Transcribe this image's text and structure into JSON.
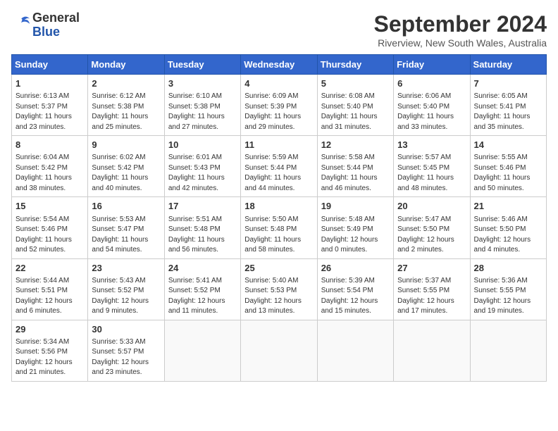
{
  "logo": {
    "general": "General",
    "blue": "Blue"
  },
  "header": {
    "month": "September 2024",
    "subtitle": "Riverview, New South Wales, Australia"
  },
  "weekdays": [
    "Sunday",
    "Monday",
    "Tuesday",
    "Wednesday",
    "Thursday",
    "Friday",
    "Saturday"
  ],
  "weeks": [
    [
      {
        "day": "1",
        "sunrise": "6:13 AM",
        "sunset": "5:37 PM",
        "daylight": "11 hours and 23 minutes."
      },
      {
        "day": "2",
        "sunrise": "6:12 AM",
        "sunset": "5:38 PM",
        "daylight": "11 hours and 25 minutes."
      },
      {
        "day": "3",
        "sunrise": "6:10 AM",
        "sunset": "5:38 PM",
        "daylight": "11 hours and 27 minutes."
      },
      {
        "day": "4",
        "sunrise": "6:09 AM",
        "sunset": "5:39 PM",
        "daylight": "11 hours and 29 minutes."
      },
      {
        "day": "5",
        "sunrise": "6:08 AM",
        "sunset": "5:40 PM",
        "daylight": "11 hours and 31 minutes."
      },
      {
        "day": "6",
        "sunrise": "6:06 AM",
        "sunset": "5:40 PM",
        "daylight": "11 hours and 33 minutes."
      },
      {
        "day": "7",
        "sunrise": "6:05 AM",
        "sunset": "5:41 PM",
        "daylight": "11 hours and 35 minutes."
      }
    ],
    [
      {
        "day": "8",
        "sunrise": "6:04 AM",
        "sunset": "5:42 PM",
        "daylight": "11 hours and 38 minutes."
      },
      {
        "day": "9",
        "sunrise": "6:02 AM",
        "sunset": "5:42 PM",
        "daylight": "11 hours and 40 minutes."
      },
      {
        "day": "10",
        "sunrise": "6:01 AM",
        "sunset": "5:43 PM",
        "daylight": "11 hours and 42 minutes."
      },
      {
        "day": "11",
        "sunrise": "5:59 AM",
        "sunset": "5:44 PM",
        "daylight": "11 hours and 44 minutes."
      },
      {
        "day": "12",
        "sunrise": "5:58 AM",
        "sunset": "5:44 PM",
        "daylight": "11 hours and 46 minutes."
      },
      {
        "day": "13",
        "sunrise": "5:57 AM",
        "sunset": "5:45 PM",
        "daylight": "11 hours and 48 minutes."
      },
      {
        "day": "14",
        "sunrise": "5:55 AM",
        "sunset": "5:46 PM",
        "daylight": "11 hours and 50 minutes."
      }
    ],
    [
      {
        "day": "15",
        "sunrise": "5:54 AM",
        "sunset": "5:46 PM",
        "daylight": "11 hours and 52 minutes."
      },
      {
        "day": "16",
        "sunrise": "5:53 AM",
        "sunset": "5:47 PM",
        "daylight": "11 hours and 54 minutes."
      },
      {
        "day": "17",
        "sunrise": "5:51 AM",
        "sunset": "5:48 PM",
        "daylight": "11 hours and 56 minutes."
      },
      {
        "day": "18",
        "sunrise": "5:50 AM",
        "sunset": "5:48 PM",
        "daylight": "11 hours and 58 minutes."
      },
      {
        "day": "19",
        "sunrise": "5:48 AM",
        "sunset": "5:49 PM",
        "daylight": "12 hours and 0 minutes."
      },
      {
        "day": "20",
        "sunrise": "5:47 AM",
        "sunset": "5:50 PM",
        "daylight": "12 hours and 2 minutes."
      },
      {
        "day": "21",
        "sunrise": "5:46 AM",
        "sunset": "5:50 PM",
        "daylight": "12 hours and 4 minutes."
      }
    ],
    [
      {
        "day": "22",
        "sunrise": "5:44 AM",
        "sunset": "5:51 PM",
        "daylight": "12 hours and 6 minutes."
      },
      {
        "day": "23",
        "sunrise": "5:43 AM",
        "sunset": "5:52 PM",
        "daylight": "12 hours and 9 minutes."
      },
      {
        "day": "24",
        "sunrise": "5:41 AM",
        "sunset": "5:52 PM",
        "daylight": "12 hours and 11 minutes."
      },
      {
        "day": "25",
        "sunrise": "5:40 AM",
        "sunset": "5:53 PM",
        "daylight": "12 hours and 13 minutes."
      },
      {
        "day": "26",
        "sunrise": "5:39 AM",
        "sunset": "5:54 PM",
        "daylight": "12 hours and 15 minutes."
      },
      {
        "day": "27",
        "sunrise": "5:37 AM",
        "sunset": "5:55 PM",
        "daylight": "12 hours and 17 minutes."
      },
      {
        "day": "28",
        "sunrise": "5:36 AM",
        "sunset": "5:55 PM",
        "daylight": "12 hours and 19 minutes."
      }
    ],
    [
      {
        "day": "29",
        "sunrise": "5:34 AM",
        "sunset": "5:56 PM",
        "daylight": "12 hours and 21 minutes."
      },
      {
        "day": "30",
        "sunrise": "5:33 AM",
        "sunset": "5:57 PM",
        "daylight": "12 hours and 23 minutes."
      },
      null,
      null,
      null,
      null,
      null
    ]
  ],
  "labels": {
    "sunrise": "Sunrise:",
    "sunset": "Sunset:",
    "daylight": "Daylight:"
  }
}
